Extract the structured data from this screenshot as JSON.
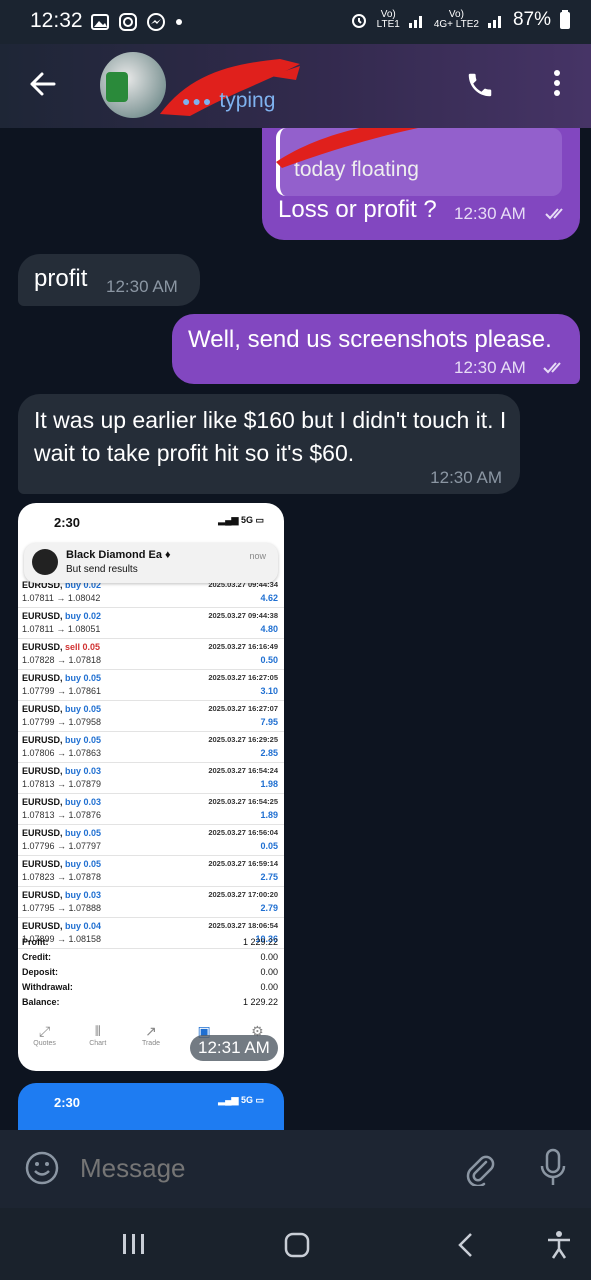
{
  "status_bar": {
    "time": "12:32",
    "net1": "LTE1",
    "net2": "4G+ LTE2",
    "battery": "87%"
  },
  "header": {
    "status": "typing"
  },
  "messages": {
    "m1_reply": "today floating",
    "m1_text": "Loss or profit ?",
    "m1_time": "12:30 AM",
    "m2_text": "profit",
    "m2_time": "12:30 AM",
    "m3_text": "Well, send us screenshots please.",
    "m3_time": "12:30 AM",
    "m4_text": "It was up earlier like $160 but I didn't touch it. I wait to take profit hit so it's $60.",
    "m4_time": "12:30 AM",
    "m5_time": "12:31 AM"
  },
  "screenshot": {
    "time": "2:30",
    "signal": "5G",
    "notif_title": "Black Diamond Ea ♦",
    "notif_sub": "But send results",
    "notif_when": "now",
    "trades": [
      {
        "sym": "EURUSD,",
        "side": "buy 0.02",
        "px": "1.07811 → 1.08042",
        "dt": "2025.03.27 09:44:34",
        "pl": "4.62"
      },
      {
        "sym": "EURUSD,",
        "side": "buy 0.02",
        "px": "1.07811 → 1.08051",
        "dt": "2025.03.27 09:44:38",
        "pl": "4.80"
      },
      {
        "sym": "EURUSD,",
        "side": "sell 0.05",
        "px": "1.07828 → 1.07818",
        "dt": "2025.03.27 16:16:49",
        "pl": "0.50"
      },
      {
        "sym": "EURUSD,",
        "side": "buy 0.05",
        "px": "1.07799 → 1.07861",
        "dt": "2025.03.27 16:27:05",
        "pl": "3.10"
      },
      {
        "sym": "EURUSD,",
        "side": "buy 0.05",
        "px": "1.07799 → 1.07958",
        "dt": "2025.03.27 16:27:07",
        "pl": "7.95"
      },
      {
        "sym": "EURUSD,",
        "side": "buy 0.05",
        "px": "1.07806 → 1.07863",
        "dt": "2025.03.27 16:29:25",
        "pl": "2.85"
      },
      {
        "sym": "EURUSD,",
        "side": "buy 0.03",
        "px": "1.07813 → 1.07879",
        "dt": "2025.03.27 16:54:24",
        "pl": "1.98"
      },
      {
        "sym": "EURUSD,",
        "side": "buy 0.03",
        "px": "1.07813 → 1.07876",
        "dt": "2025.03.27 16:54:25",
        "pl": "1.89"
      },
      {
        "sym": "EURUSD,",
        "side": "buy 0.05",
        "px": "1.07796 → 1.07797",
        "dt": "2025.03.27 16:56:04",
        "pl": "0.05"
      },
      {
        "sym": "EURUSD,",
        "side": "buy 0.05",
        "px": "1.07823 → 1.07878",
        "dt": "2025.03.27 16:59:14",
        "pl": "2.75"
      },
      {
        "sym": "EURUSD,",
        "side": "buy 0.03",
        "px": "1.07795 → 1.07888",
        "dt": "2025.03.27 17:00:20",
        "pl": "2.79"
      },
      {
        "sym": "EURUSD,",
        "side": "buy 0.04",
        "px": "1.07899 → 1.08158",
        "dt": "2025.03.27 18:06:54",
        "pl": "10.36"
      }
    ],
    "totals": [
      {
        "k": "Profit:",
        "v": "1 229.22"
      },
      {
        "k": "Credit:",
        "v": "0.00"
      },
      {
        "k": "Deposit:",
        "v": "0.00"
      },
      {
        "k": "Withdrawal:",
        "v": "0.00"
      },
      {
        "k": "Balance:",
        "v": "1 229.22"
      }
    ],
    "nav": [
      "Quotes",
      "Chart",
      "Trade"
    ]
  },
  "screenshot2": {
    "time": "2:30",
    "signal": "5G"
  },
  "input": {
    "placeholder": "Message"
  },
  "colors": {
    "bubble_out": "#8247c0",
    "bubble_in": "#252d38",
    "accent_typing": "#7fb2ef"
  }
}
